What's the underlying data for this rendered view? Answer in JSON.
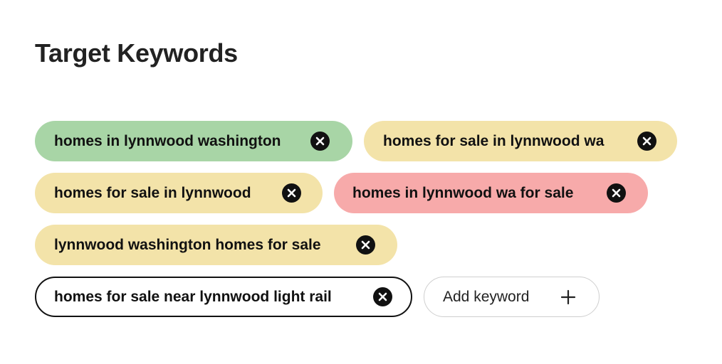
{
  "title": "Target Keywords",
  "keywords": [
    {
      "label": "homes in lynnwood washington",
      "color": "#a8d5a6"
    },
    {
      "label": "homes for sale in lynnwood wa",
      "color": "#f3e3a9"
    },
    {
      "label": "homes for sale in lynnwood",
      "color": "#f3e3a9"
    },
    {
      "label": "homes in lynnwood wa for sale",
      "color": "#f7aaaa"
    },
    {
      "label": "lynnwood washington homes for sale",
      "color": "#f3e3a9"
    },
    {
      "label": "homes for sale near lynnwood light rail",
      "color": "#ffffff"
    }
  ],
  "remove_icon": "close-circle-icon",
  "add_keyword": {
    "label": "Add keyword",
    "icon": "plus-icon"
  }
}
